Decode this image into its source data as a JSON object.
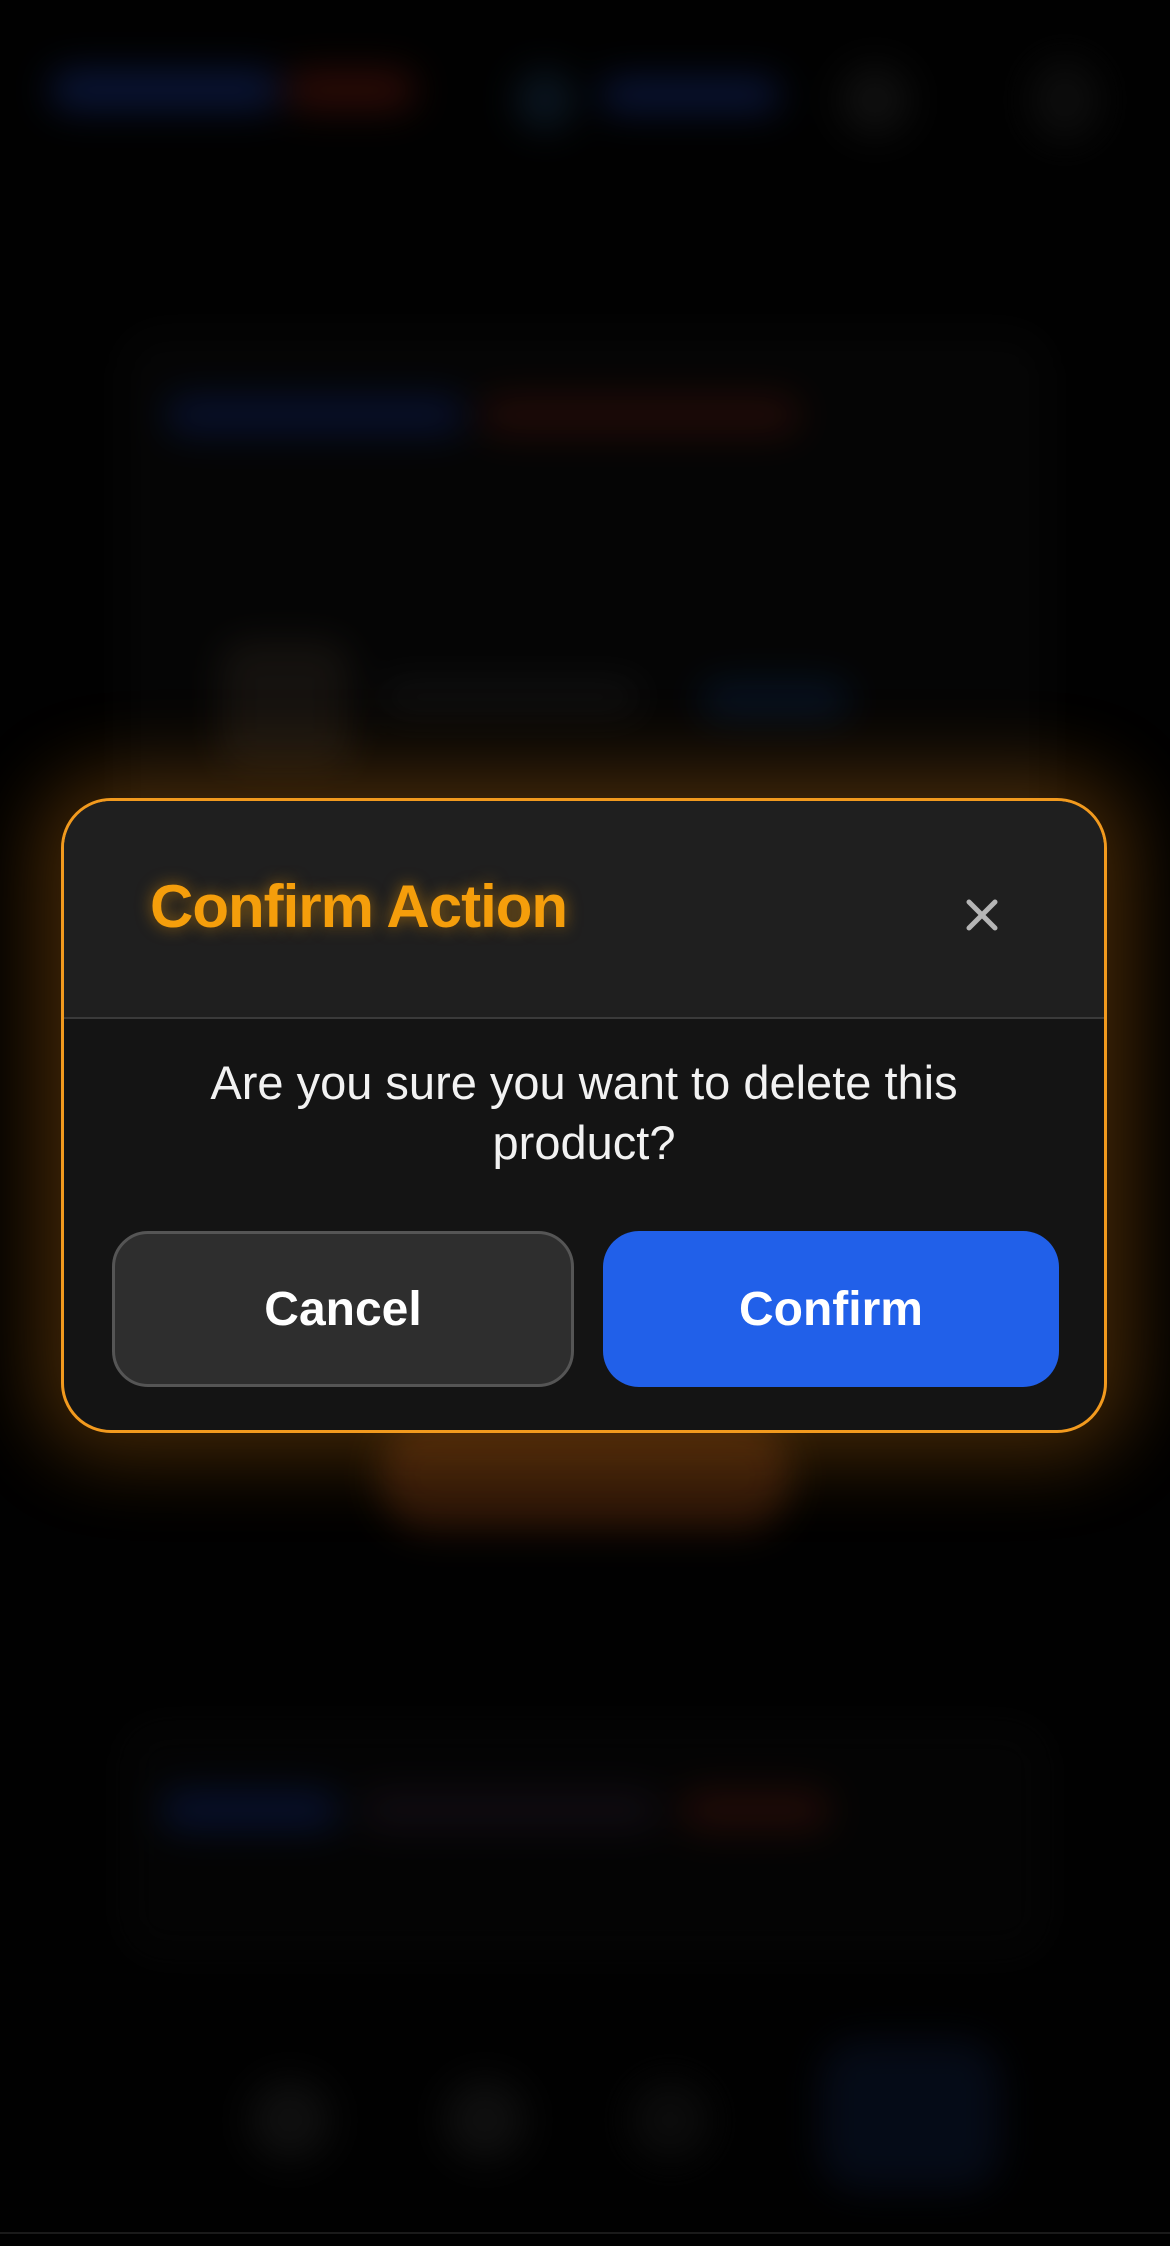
{
  "dialog": {
    "title": "Confirm Action",
    "close_icon": "close-icon",
    "message": "Are you sure you want to delete this product?",
    "cancel_label": "Cancel",
    "confirm_label": "Confirm"
  },
  "colors": {
    "accent": "#f59e0b",
    "confirm": "#2160e9",
    "cancel_bg": "#2e2e2e",
    "modal_bg": "#141414"
  }
}
